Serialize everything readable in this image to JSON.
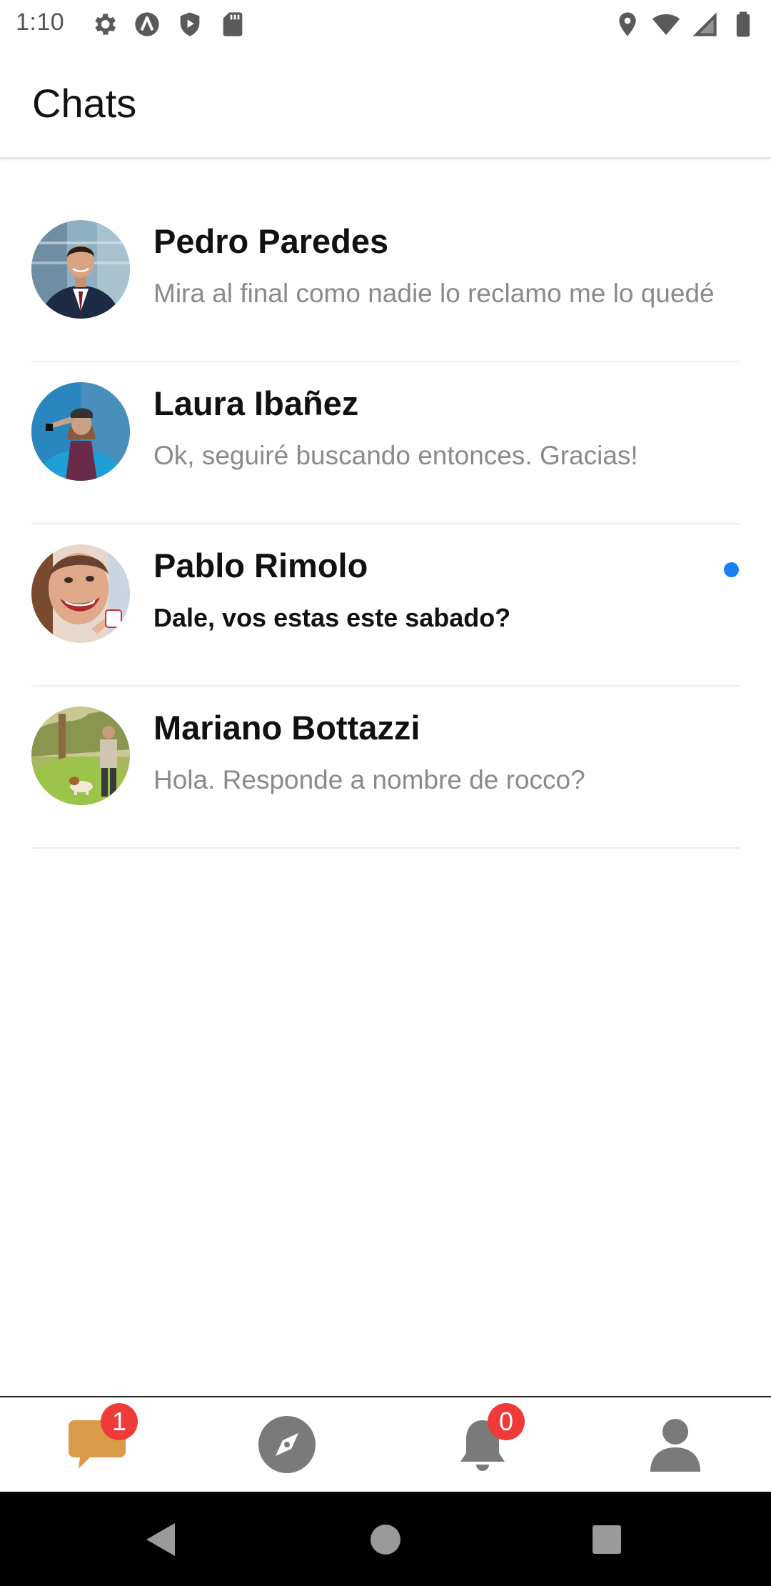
{
  "status_bar": {
    "time": "1:10",
    "left_icons": [
      "settings-icon",
      "app-a-icon",
      "shield-play-icon",
      "sd-card-icon"
    ],
    "right_icons": [
      "location-icon",
      "wifi-icon",
      "cell-signal-icon",
      "battery-icon"
    ]
  },
  "header": {
    "title": "Chats"
  },
  "chats": [
    {
      "name": "Pedro Paredes",
      "preview": "Mira al final como nadie lo reclamo me lo quedé",
      "unread": false
    },
    {
      "name": "Laura Ibañez",
      "preview": "Ok, seguiré buscando entonces. Gracias!",
      "unread": false
    },
    {
      "name": "Pablo Rimolo",
      "preview": "Dale, vos estas este sabado?",
      "unread": true
    },
    {
      "name": "Mariano Bottazzi",
      "preview": "Hola. Responde a nombre de rocco?",
      "unread": false
    }
  ],
  "bottom_nav": {
    "items": [
      {
        "icon": "chat-bubble-icon",
        "badge": "1",
        "active": true
      },
      {
        "icon": "compass-icon",
        "badge": null,
        "active": false
      },
      {
        "icon": "bell-icon",
        "badge": "0",
        "active": false
      },
      {
        "icon": "profile-icon",
        "badge": null,
        "active": false
      }
    ]
  },
  "system_nav": {
    "buttons": [
      "back-icon",
      "home-icon",
      "recents-icon"
    ]
  },
  "colors": {
    "accent": "#d99a4a",
    "badge": "#f03a3a",
    "unread_dot": "#1a7ff0",
    "nav_icon_inactive": "#7a7a7a",
    "preview_text": "#8a8a8a"
  }
}
